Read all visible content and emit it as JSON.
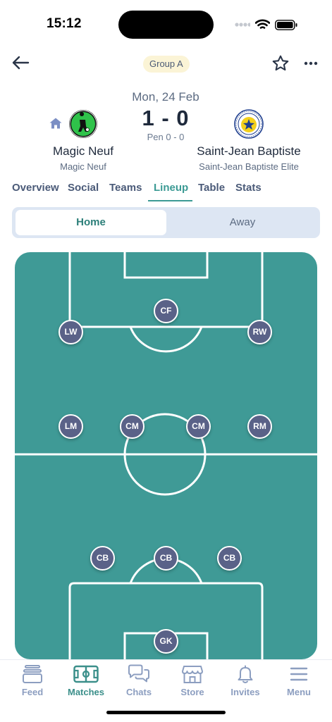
{
  "status_bar": {
    "time": "15:12"
  },
  "header": {
    "group_badge": "Group A",
    "back_icon": "arrow-left-icon",
    "favorite_icon": "star-outline-icon",
    "more_icon": "more-dots-icon"
  },
  "match": {
    "date": "Mon, 24 Feb",
    "score": "1 - 0",
    "penalties": "Pen 0 - 0",
    "home": {
      "name": "Magic Neuf",
      "subtitle": "Magic Neuf",
      "is_home": true
    },
    "away": {
      "name": "Saint-Jean Baptiste",
      "subtitle": "Saint-Jean Baptiste Elite"
    }
  },
  "tabs": [
    {
      "label": "Overview",
      "active": false
    },
    {
      "label": "Social",
      "active": false
    },
    {
      "label": "Teams",
      "active": false
    },
    {
      "label": "Lineup",
      "active": true
    },
    {
      "label": "Table",
      "active": false
    },
    {
      "label": "Stats",
      "active": false
    }
  ],
  "lineup_toggle": {
    "home_label": "Home",
    "away_label": "Away",
    "selected": "Home"
  },
  "pitch": {
    "positions": [
      "CF",
      "LW",
      "RW",
      "LM",
      "CM",
      "CM",
      "RM",
      "CB",
      "CB",
      "CB",
      "GK"
    ]
  },
  "bottom_nav": [
    {
      "label": "Feed",
      "icon": "feed-icon",
      "active": false
    },
    {
      "label": "Matches",
      "icon": "pitch-icon",
      "active": true
    },
    {
      "label": "Chats",
      "icon": "chat-bubbles-icon",
      "active": false
    },
    {
      "label": "Store",
      "icon": "store-icon",
      "active": false
    },
    {
      "label": "Invites",
      "icon": "bell-icon",
      "active": false
    },
    {
      "label": "Menu",
      "icon": "menu-icon",
      "active": false
    }
  ],
  "colors": {
    "pitch": "#3f9a96",
    "accent": "#3b9a94",
    "position_marker": "#5a6288",
    "badge_bg": "#fbf4d6"
  }
}
